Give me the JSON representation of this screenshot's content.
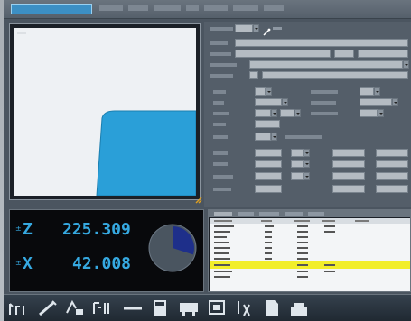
{
  "colors": {
    "accent": "#36a9e1",
    "highlight_row": "#f2ee2a",
    "workpiece": "#2a9fd8",
    "panel": "#545e69"
  },
  "dro": {
    "z_label": "Z",
    "z_value": "225.309",
    "x_label": "X",
    "x_value": "42.008",
    "feed_gauge_fraction": 0.3
  },
  "toolbar": {
    "icons": [
      "jog-axis-icon",
      "tool-icon",
      "tool-setup-icon",
      "program-icon",
      "minus-icon",
      "calculator-icon",
      "machine-icon",
      "screen-icon",
      "probe-icon",
      "document-icon",
      "settings-icon"
    ]
  }
}
